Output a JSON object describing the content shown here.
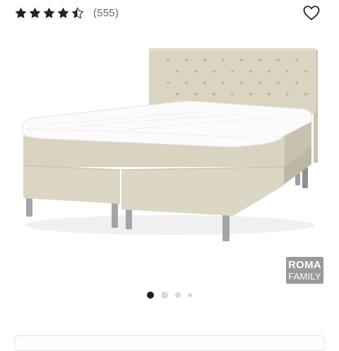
{
  "rating": {
    "value": 4.5,
    "max": 5,
    "review_count": "(555)",
    "star_color": "#222222"
  },
  "wishlist": {
    "icon": "heart-outline-icon"
  },
  "product": {
    "image": "beige-continental-bed",
    "upholstery_color": "#dcd6c4",
    "badge": {
      "line1": "ROMA",
      "line2": "FAMILY"
    }
  },
  "carousel": {
    "count": 4,
    "active_index": 0
  }
}
